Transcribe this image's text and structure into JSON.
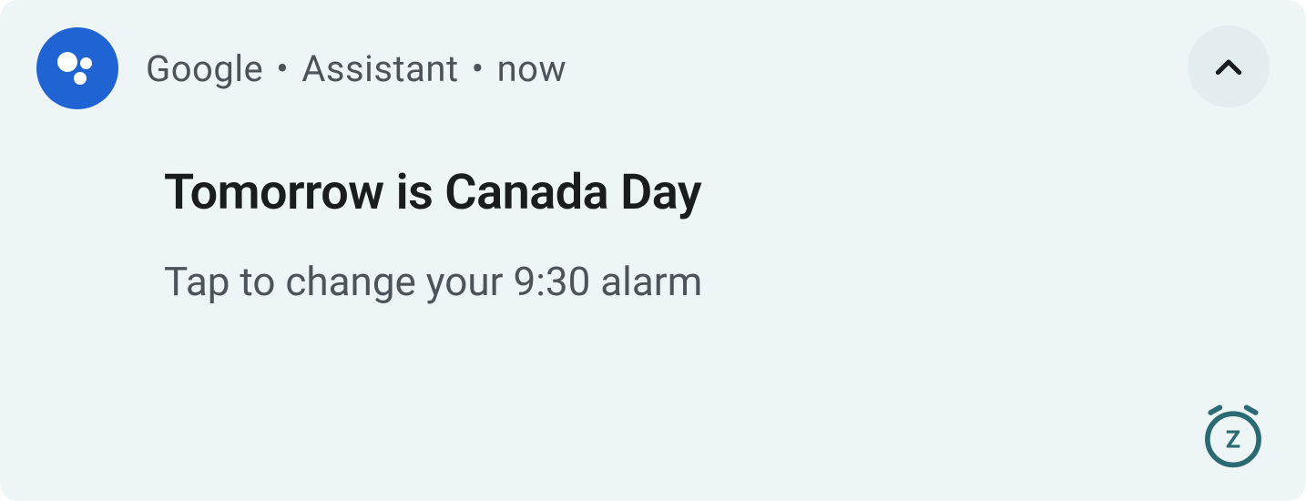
{
  "notification": {
    "app_name": "Google",
    "app_category": "Assistant",
    "timestamp": "now",
    "title": "Tomorrow is Canada Day",
    "subtitle": "Tap to change your 9:30 alarm",
    "icon_name": "google-assistant",
    "colors": {
      "background": "#eef5f7",
      "icon_bg": "#2064d4",
      "text_primary": "#1a1d1f",
      "text_secondary": "#4a5459",
      "expand_bg": "#e3ecef",
      "alarm_icon": "#2a6a72"
    }
  }
}
